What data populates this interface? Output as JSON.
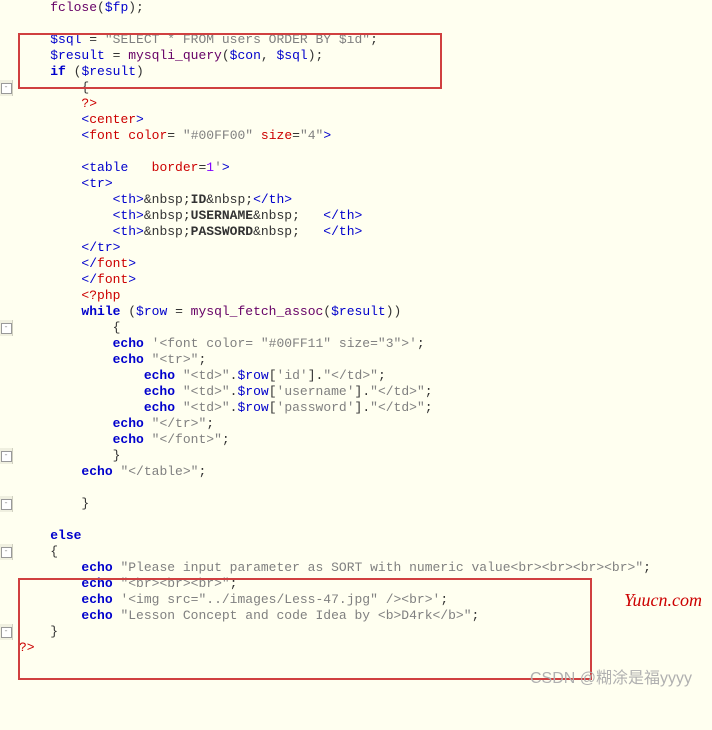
{
  "lines": [
    {
      "g": "",
      "indent": "    ",
      "parts": [
        {
          "c": "func",
          "t": "fclose"
        },
        {
          "c": "plain",
          "t": "("
        },
        {
          "c": "var",
          "t": "$fp"
        },
        {
          "c": "plain",
          "t": ");"
        }
      ]
    },
    {
      "g": "",
      "indent": "",
      "parts": []
    },
    {
      "g": "",
      "indent": "    ",
      "parts": [
        {
          "c": "var",
          "t": "$sql"
        },
        {
          "c": "plain",
          "t": " = "
        },
        {
          "c": "str",
          "t": "\"SELECT * FROM users ORDER BY $id\""
        },
        {
          "c": "plain",
          "t": ";"
        }
      ]
    },
    {
      "g": "",
      "indent": "    ",
      "parts": [
        {
          "c": "var",
          "t": "$result"
        },
        {
          "c": "plain",
          "t": " = "
        },
        {
          "c": "func",
          "t": "mysqli_query"
        },
        {
          "c": "plain",
          "t": "("
        },
        {
          "c": "var",
          "t": "$con"
        },
        {
          "c": "plain",
          "t": ", "
        },
        {
          "c": "var",
          "t": "$sql"
        },
        {
          "c": "plain",
          "t": ");"
        }
      ]
    },
    {
      "g": "",
      "indent": "    ",
      "parts": [
        {
          "c": "kw",
          "t": "if"
        },
        {
          "c": "plain",
          "t": " ("
        },
        {
          "c": "var",
          "t": "$result"
        },
        {
          "c": "plain",
          "t": ")"
        }
      ]
    },
    {
      "g": "-",
      "indent": "        ",
      "parts": [
        {
          "c": "plain",
          "t": "{"
        }
      ]
    },
    {
      "g": "",
      "indent": "        ",
      "parts": [
        {
          "c": "phptag",
          "t": "?>"
        }
      ]
    },
    {
      "g": "",
      "indent": "        ",
      "parts": [
        {
          "c": "tag",
          "t": "<"
        },
        {
          "c": "err",
          "t": "center"
        },
        {
          "c": "tag",
          "t": ">"
        }
      ]
    },
    {
      "g": "",
      "indent": "        ",
      "parts": [
        {
          "c": "tag",
          "t": "<"
        },
        {
          "c": "err",
          "t": "font"
        },
        {
          "c": "plain",
          "t": " "
        },
        {
          "c": "attr",
          "t": "color"
        },
        {
          "c": "plain",
          "t": "="
        },
        {
          "c": "str",
          "t": " \"#00FF00\""
        },
        {
          "c": "plain",
          "t": " "
        },
        {
          "c": "attr",
          "t": "size"
        },
        {
          "c": "plain",
          "t": "="
        },
        {
          "c": "str",
          "t": "\"4\""
        },
        {
          "c": "tag",
          "t": ">"
        }
      ]
    },
    {
      "g": "",
      "indent": "",
      "parts": []
    },
    {
      "g": "",
      "indent": "        ",
      "parts": [
        {
          "c": "tag",
          "t": "<"
        },
        {
          "c": "tag",
          "t": "table"
        },
        {
          "c": "plain",
          "t": "   "
        },
        {
          "c": "attr",
          "t": "border"
        },
        {
          "c": "plain",
          "t": "="
        },
        {
          "c": "attrval",
          "t": "1"
        },
        {
          "c": "str",
          "t": "'"
        },
        {
          "c": "tag",
          "t": ">"
        }
      ]
    },
    {
      "g": "",
      "indent": "        ",
      "parts": [
        {
          "c": "tag",
          "t": "<tr>"
        }
      ]
    },
    {
      "g": "",
      "indent": "            ",
      "parts": [
        {
          "c": "tag",
          "t": "<th>"
        },
        {
          "c": "plain",
          "t": "&nbsp;"
        },
        {
          "c": "plain bold",
          "t": "ID"
        },
        {
          "c": "plain",
          "t": "&nbsp;"
        },
        {
          "c": "tag",
          "t": "</th>"
        }
      ]
    },
    {
      "g": "",
      "indent": "            ",
      "parts": [
        {
          "c": "tag",
          "t": "<th>"
        },
        {
          "c": "plain",
          "t": "&nbsp;"
        },
        {
          "c": "plain bold",
          "t": "USERNAME"
        },
        {
          "c": "plain",
          "t": "&nbsp;   "
        },
        {
          "c": "tag",
          "t": "</th>"
        }
      ]
    },
    {
      "g": "",
      "indent": "            ",
      "parts": [
        {
          "c": "tag",
          "t": "<th>"
        },
        {
          "c": "plain",
          "t": "&nbsp;"
        },
        {
          "c": "plain bold",
          "t": "PASSWORD"
        },
        {
          "c": "plain",
          "t": "&nbsp;   "
        },
        {
          "c": "tag",
          "t": "</th>"
        }
      ]
    },
    {
      "g": "",
      "indent": "        ",
      "parts": [
        {
          "c": "tag",
          "t": "</tr>"
        }
      ]
    },
    {
      "g": "",
      "indent": "        ",
      "parts": [
        {
          "c": "tag",
          "t": "</"
        },
        {
          "c": "err",
          "t": "font"
        },
        {
          "c": "tag",
          "t": ">"
        }
      ]
    },
    {
      "g": "",
      "indent": "        ",
      "parts": [
        {
          "c": "tag",
          "t": "</"
        },
        {
          "c": "err",
          "t": "font"
        },
        {
          "c": "tag",
          "t": ">"
        }
      ]
    },
    {
      "g": "",
      "indent": "        ",
      "parts": [
        {
          "c": "phptag",
          "t": "<?php"
        }
      ]
    },
    {
      "g": "",
      "indent": "        ",
      "parts": [
        {
          "c": "kw",
          "t": "while"
        },
        {
          "c": "plain",
          "t": " ("
        },
        {
          "c": "var",
          "t": "$row"
        },
        {
          "c": "plain",
          "t": " = "
        },
        {
          "c": "func",
          "t": "mysql_fetch_assoc"
        },
        {
          "c": "plain",
          "t": "("
        },
        {
          "c": "var",
          "t": "$result"
        },
        {
          "c": "plain",
          "t": "))"
        }
      ]
    },
    {
      "g": "-",
      "indent": "            ",
      "parts": [
        {
          "c": "plain",
          "t": "{"
        }
      ]
    },
    {
      "g": "",
      "indent": "            ",
      "parts": [
        {
          "c": "kw",
          "t": "echo"
        },
        {
          "c": "plain",
          "t": " "
        },
        {
          "c": "str",
          "t": "'<font color= \"#00FF11\" size=\"3\">'"
        },
        {
          "c": "plain",
          "t": ";"
        }
      ]
    },
    {
      "g": "",
      "indent": "            ",
      "parts": [
        {
          "c": "kw",
          "t": "echo"
        },
        {
          "c": "plain",
          "t": " "
        },
        {
          "c": "str",
          "t": "\"<tr>\""
        },
        {
          "c": "plain",
          "t": ";"
        }
      ]
    },
    {
      "g": "",
      "indent": "                ",
      "parts": [
        {
          "c": "kw",
          "t": "echo"
        },
        {
          "c": "plain",
          "t": " "
        },
        {
          "c": "str",
          "t": "\"<td>\""
        },
        {
          "c": "plain",
          "t": "."
        },
        {
          "c": "var",
          "t": "$row"
        },
        {
          "c": "plain",
          "t": "["
        },
        {
          "c": "str",
          "t": "'id'"
        },
        {
          "c": "plain",
          "t": "]."
        },
        {
          "c": "str",
          "t": "\"</td>\""
        },
        {
          "c": "plain",
          "t": ";"
        }
      ]
    },
    {
      "g": "",
      "indent": "                ",
      "parts": [
        {
          "c": "kw",
          "t": "echo"
        },
        {
          "c": "plain",
          "t": " "
        },
        {
          "c": "str",
          "t": "\"<td>\""
        },
        {
          "c": "plain",
          "t": "."
        },
        {
          "c": "var",
          "t": "$row"
        },
        {
          "c": "plain",
          "t": "["
        },
        {
          "c": "str",
          "t": "'username'"
        },
        {
          "c": "plain",
          "t": "]."
        },
        {
          "c": "str",
          "t": "\"</td>\""
        },
        {
          "c": "plain",
          "t": ";"
        }
      ]
    },
    {
      "g": "",
      "indent": "                ",
      "parts": [
        {
          "c": "kw",
          "t": "echo"
        },
        {
          "c": "plain",
          "t": " "
        },
        {
          "c": "str",
          "t": "\"<td>\""
        },
        {
          "c": "plain",
          "t": "."
        },
        {
          "c": "var",
          "t": "$row"
        },
        {
          "c": "plain",
          "t": "["
        },
        {
          "c": "str",
          "t": "'password'"
        },
        {
          "c": "plain",
          "t": "]."
        },
        {
          "c": "str",
          "t": "\"</td>\""
        },
        {
          "c": "plain",
          "t": ";"
        }
      ]
    },
    {
      "g": "",
      "indent": "            ",
      "parts": [
        {
          "c": "kw",
          "t": "echo"
        },
        {
          "c": "plain",
          "t": " "
        },
        {
          "c": "str",
          "t": "\"</tr>\""
        },
        {
          "c": "plain",
          "t": ";"
        }
      ]
    },
    {
      "g": "",
      "indent": "            ",
      "parts": [
        {
          "c": "kw",
          "t": "echo"
        },
        {
          "c": "plain",
          "t": " "
        },
        {
          "c": "str",
          "t": "\"</font>\""
        },
        {
          "c": "plain",
          "t": ";"
        }
      ]
    },
    {
      "g": "-",
      "indent": "            ",
      "parts": [
        {
          "c": "plain",
          "t": "}"
        }
      ]
    },
    {
      "g": "",
      "indent": "        ",
      "parts": [
        {
          "c": "kw",
          "t": "echo"
        },
        {
          "c": "plain",
          "t": " "
        },
        {
          "c": "str",
          "t": "\"</table>\""
        },
        {
          "c": "plain",
          "t": ";"
        }
      ]
    },
    {
      "g": "",
      "indent": "",
      "parts": []
    },
    {
      "g": "-",
      "indent": "        ",
      "parts": [
        {
          "c": "plain",
          "t": "}"
        }
      ]
    },
    {
      "g": "",
      "indent": "",
      "parts": []
    },
    {
      "g": "",
      "indent": "    ",
      "parts": [
        {
          "c": "kw",
          "t": "else"
        }
      ]
    },
    {
      "g": "-",
      "indent": "    ",
      "parts": [
        {
          "c": "plain",
          "t": "{"
        }
      ]
    },
    {
      "g": "",
      "indent": "        ",
      "parts": [
        {
          "c": "kw",
          "t": "echo"
        },
        {
          "c": "plain",
          "t": " "
        },
        {
          "c": "str",
          "t": "\"Please input parameter as SORT with numeric value<br><br><br><br>\""
        },
        {
          "c": "plain",
          "t": ";"
        }
      ]
    },
    {
      "g": "",
      "indent": "        ",
      "parts": [
        {
          "c": "kw",
          "t": "echo"
        },
        {
          "c": "plain",
          "t": " "
        },
        {
          "c": "str",
          "t": "\"<br><br><br>\""
        },
        {
          "c": "plain",
          "t": ";"
        }
      ]
    },
    {
      "g": "",
      "indent": "        ",
      "parts": [
        {
          "c": "kw",
          "t": "echo"
        },
        {
          "c": "plain",
          "t": " "
        },
        {
          "c": "str",
          "t": "'<img src=\"../images/Less-47.jpg\" /><br>'"
        },
        {
          "c": "plain",
          "t": ";"
        }
      ]
    },
    {
      "g": "",
      "indent": "        ",
      "parts": [
        {
          "c": "kw",
          "t": "echo"
        },
        {
          "c": "plain",
          "t": " "
        },
        {
          "c": "str",
          "t": "\"Lesson Concept and code Idea by <b>D4rk</b>\""
        },
        {
          "c": "plain",
          "t": ";"
        }
      ]
    },
    {
      "g": "-",
      "indent": "    ",
      "parts": [
        {
          "c": "plain",
          "t": "}"
        }
      ]
    },
    {
      "g": "",
      "indent": "",
      "parts": [
        {
          "c": "phptag",
          "t": "?>"
        }
      ]
    }
  ],
  "watermarkRight": "Yuucn.com",
  "watermarkBottom": "CSDN @糊涂是福yyyy"
}
